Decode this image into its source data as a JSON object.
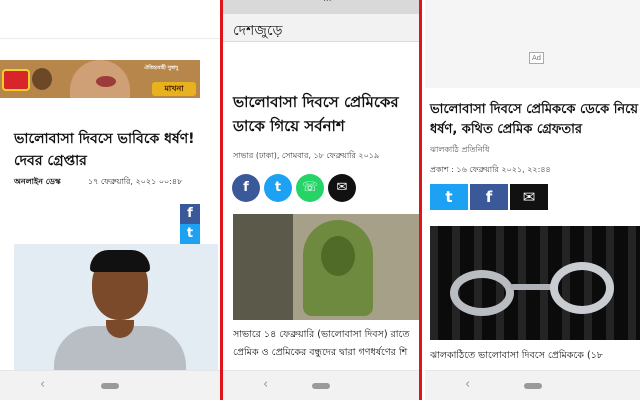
{
  "panel1": {
    "ad": {
      "small_text": "ঐতিহ্যবাহী সুস্বাদু",
      "brand": "মাখনা"
    },
    "headline": "ভালোবাসা দিবসে ভাবিকে ধর্ষণ! দেবর গ্রেপ্তার",
    "byline": "অনলাইন ডেস্ক",
    "date": "১৭ ফেব্রুয়ারি, ২০২১ ০০:৪৮",
    "share": {
      "facebook": "f",
      "twitter": "t"
    }
  },
  "panel2": {
    "topbar_text": "...",
    "section_title": "দেশজুড়ে",
    "headline": "ভালোবাসা দিবসে প্রেমিকের ডাকে গিয়ে সর্বনাশ",
    "dateline": "সাভার (ঢাকা), সোমবার, ১৮ ফেব্রুয়ারি ২০১৯",
    "share": {
      "facebook": "f",
      "twitter": "t",
      "whatsapp": "☏",
      "email": "✉"
    },
    "caption_line1": "সাভারে ১৪ ফেব্রুয়ারি (ভালোবাসা দিবস) রাতে",
    "caption_line2": "প্রেমিক ও প্রেমিকের বন্ধুদের দ্বারা গণধর্ষণের শি"
  },
  "panel3": {
    "ad_label": "Ad",
    "headline": "ভালোবাসা দিবসে প্রেমিককে ডেকে নিয়ে ধর্ষণ, কথিত প্রেমিক গ্রেফতার",
    "source": "ঝালকাঠি প্রতিনিধি",
    "pubdate": "প্রকাশ : ১৬ ফেব্রুয়ারি ২০২১, ২২:৪৪",
    "share": {
      "twitter": "t",
      "facebook": "f",
      "email": "✉"
    },
    "caption": "ঝালকাঠিতে ভালোবাসা দিবসে প্রেমিককে (১৮"
  },
  "nav": {
    "back": "‹"
  },
  "colors": {
    "divider": "#e0151b",
    "facebook": "#3b5998",
    "twitter": "#1da1f2",
    "whatsapp": "#25d366"
  }
}
